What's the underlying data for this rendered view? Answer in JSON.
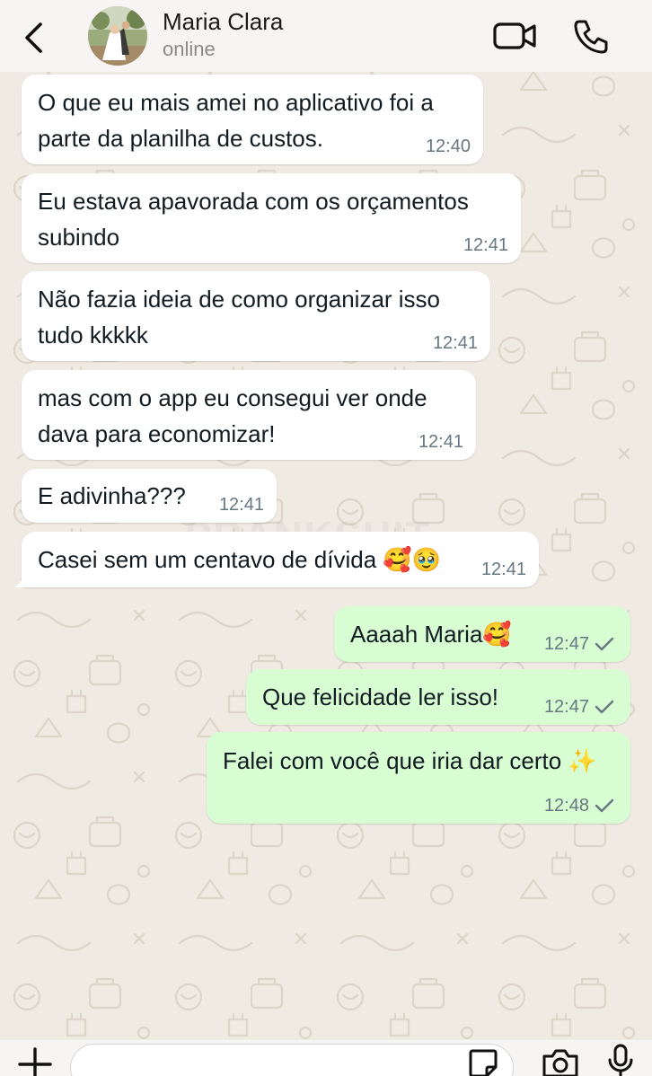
{
  "header": {
    "contact_name": "Maria Clara",
    "status": "online",
    "icons": {
      "back": "chevron-left-icon",
      "video": "video-camera-icon",
      "call": "phone-icon"
    }
  },
  "watermark": "PRANKSHIT",
  "messages": [
    {
      "direction": "in",
      "lines": [
        "O que eu mais amei no aplicativo foi a",
        "parte da planilha de custos."
      ],
      "time": "12:40"
    },
    {
      "direction": "in",
      "lines": [
        "Eu estava apavorada com os orçamentos",
        "subindo"
      ],
      "time": "12:41"
    },
    {
      "direction": "in",
      "lines": [
        "Não fazia ideia de como organizar isso",
        "tudo kkkkk"
      ],
      "time": "12:41"
    },
    {
      "direction": "in",
      "lines": [
        "mas com o app eu consegui ver onde",
        "dava para economizar!"
      ],
      "time": "12:41"
    },
    {
      "direction": "in",
      "lines": [
        "E adivinha???"
      ],
      "time": "12:41"
    },
    {
      "direction": "in",
      "lines": [
        "Casei sem um centavo de dívida 🥰🥹"
      ],
      "time": "12:41"
    },
    {
      "direction": "out",
      "lines": [
        "Aaaah Maria🥰"
      ],
      "time": "12:47",
      "status": "sent"
    },
    {
      "direction": "out",
      "lines": [
        "Que felicidade ler isso!"
      ],
      "time": "12:47",
      "status": "sent"
    },
    {
      "direction": "out",
      "lines": [
        "Falei com você que iria dar certo ✨"
      ],
      "time": "12:48",
      "status": "sent"
    }
  ],
  "composer": {
    "placeholder": "",
    "icons": [
      "plus-icon",
      "sticker-icon",
      "camera-icon",
      "microphone-icon"
    ]
  },
  "colors": {
    "incoming_bubble": "#ffffff",
    "outgoing_bubble": "#d9fdd3",
    "chat_background": "#efeae2",
    "header_background": "#f6f5f3",
    "timestamp": "#667781"
  }
}
